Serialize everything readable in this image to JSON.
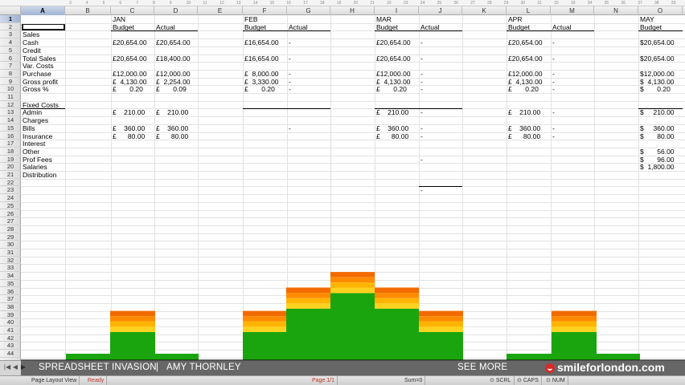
{
  "ruler_ticks": [
    "3",
    "4",
    "5",
    "6",
    "7",
    "8",
    "9",
    "10",
    "11",
    "12",
    "13",
    "14",
    "15",
    "16",
    "17",
    "18",
    "19",
    "20",
    "21",
    "22",
    "23",
    "24",
    "25",
    "26",
    "27",
    "28",
    "29",
    "30",
    "31",
    "32",
    "33",
    "34",
    "35",
    "36",
    "37",
    "38",
    "39"
  ],
  "columns": [
    "A",
    "B",
    "C",
    "D",
    "E",
    "F",
    "G",
    "H",
    "I",
    "J",
    "K",
    "L",
    "M",
    "N",
    "O"
  ],
  "rows": [
    "1",
    "2",
    "3",
    "4",
    "5",
    "6",
    "7",
    "8",
    "9",
    "10",
    "11",
    "12",
    "13",
    "14",
    "15",
    "16",
    "17",
    "18",
    "19",
    "20",
    "21",
    "22",
    "23",
    "24",
    "25",
    "26",
    "27",
    "28",
    "29",
    "30",
    "31",
    "32",
    "33",
    "34",
    "35",
    "36",
    "37",
    "38",
    "39",
    "40",
    "41",
    "42",
    "43",
    "44"
  ],
  "selected_cell": "A1",
  "months": {
    "jan": {
      "name": "JAN",
      "budget": "Budget",
      "actual": "Actual"
    },
    "feb": {
      "name": "FEB",
      "budget": "Budget",
      "actual": "Actual"
    },
    "mar": {
      "name": "MAR",
      "budget": "Budget",
      "actual": "Actual"
    },
    "apr": {
      "name": "APR",
      "budget": "Budget",
      "actual": "Actual"
    },
    "may": {
      "name": "MAY",
      "budget": "Budget"
    }
  },
  "labels": [
    "Sales",
    "Cash",
    "Credit",
    "Total Sales",
    "Var. Costs",
    "Purchase",
    "Gross profit",
    "Gross %",
    "",
    "Fixed Costs",
    "Admin",
    "Charges",
    "Bills",
    "Insurance",
    "Interest",
    "Other",
    "Prof Fees",
    "Salaries",
    "Distribution"
  ],
  "values": {
    "jan_budget": {
      "r4": "£20,654.00",
      "r6": "£20,654.00",
      "r8": "£12,000.00",
      "r9": "£  4,130.00",
      "r10": "£       0.20",
      "r13": "£    210.00",
      "r15": "£    360.00",
      "r16": "£      80.00"
    },
    "jan_actual": {
      "r4": "£20,654.00",
      "r6": "£18,400.00",
      "r8": "£12,000.00",
      "r9": "£  2,254.00",
      "r10": "£       0.09",
      "r13": "£    210.00",
      "r15": "£    360.00",
      "r16": "£      80.00"
    },
    "feb_budget": {
      "r4": "£16,654.00",
      "r6": "£16,654.00",
      "r8": "£  8,000.00",
      "r9": "£  3,330.00",
      "r10": "£       0.20"
    },
    "feb_actual": {
      "r4": "-",
      "r6": "-",
      "r8": "-",
      "r9": "-",
      "r10": "-",
      "r15": "-"
    },
    "mar_budget": {
      "r4": "£20,654.00",
      "r6": "£20,654.00",
      "r8": "£12,000.00",
      "r9": "£  4,130.00",
      "r10": "£       0.20",
      "r13": "£    210.00",
      "r15": "£    360.00",
      "r16": "£      80.00"
    },
    "mar_actual": {
      "r4": "-",
      "r6": "-",
      "r8": "-",
      "r9": "-",
      "r10": "-",
      "r13": "-",
      "r15": "-",
      "r16": "-",
      "r19": "-",
      "r23": "-"
    },
    "apr_budget": {
      "r4": "£20,654.00",
      "r6": "£20,654.00",
      "r8": "£12,000.00",
      "r9": "£  4,130.00",
      "r10": "£       0.20",
      "r13": "£    210.00",
      "r15": "£    360.00",
      "r16": "£      80.00"
    },
    "apr_actual": {
      "r4": "-",
      "r6": "-",
      "r8": "-",
      "r9": "-",
      "r10": "-",
      "r13": "-",
      "r15": "-",
      "r16": "-"
    },
    "may_budget": {
      "r4": "$20,654.00",
      "r6": "$20,654.00",
      "r8": "$12,000.00",
      "r9": "$  4,130.00",
      "r10": "$       0.20",
      "r13": "$     210.00",
      "r15": "$     360.00",
      "r16": "$       80.00",
      "r18": "$       56.00",
      "r19": "$       96.00",
      "r20": "$  1,800.00"
    }
  },
  "banner": {
    "title": "SPREADSHEET INVASION",
    "separator": "|",
    "author": "AMY THORNLEY",
    "see_more": "SEE MORE",
    "brand": "smileforlondon.com"
  },
  "status": {
    "view": "Page Layout View",
    "ready": "Ready",
    "page": "Page 1/1",
    "sum": "Sum=0",
    "scrl": "SCRL",
    "caps": "CAPS",
    "num": "NUM"
  },
  "colors": {
    "green": "#1aa50e",
    "yellow": "#ffd21f",
    "amber": "#ffb400",
    "orange": "#ff8a00",
    "deep_orange": "#f26b00"
  }
}
